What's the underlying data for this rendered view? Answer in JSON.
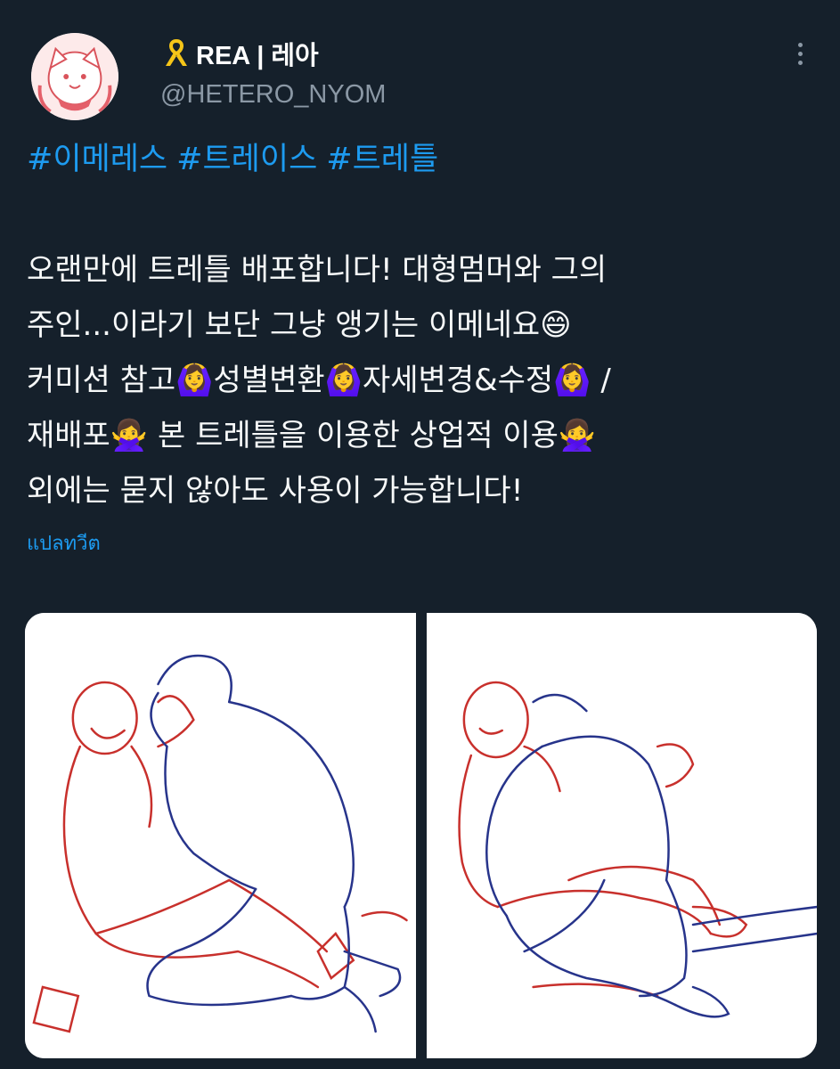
{
  "tweet": {
    "author": {
      "display_name": "REA | 레아",
      "handle": "@HETERO_NYOM",
      "badge_icon": "yellow-ribbon-icon"
    },
    "hashtags": [
      "#이메레스",
      "#트레이스",
      "#트레틀"
    ],
    "body_lines": [
      "오랜만에 트레틀 배포합니다! 대형멈머와 그의",
      "주인...이라기 보단 그냥 앵기는 이메네요😄",
      "커미션 참고🙆‍♀️성별변환🙆‍♀️자세변경&수정🙆‍♀️ /",
      "재배포🙅‍♀️ 본 트레틀을 이용한 상업적 이용🙅‍♀️",
      "외에는 묻지 않아도 사용이 가능합니다!"
    ],
    "translate_label": "แปลทวีต",
    "more_icon": "more-vertical-icon",
    "accent_color": "#1d9bf0",
    "background_color": "#15202b"
  }
}
